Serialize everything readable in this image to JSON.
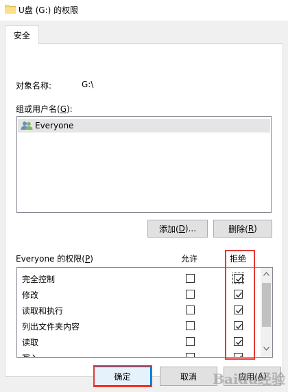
{
  "window": {
    "title": "U盘 (G:) 的权限"
  },
  "tab": {
    "label": "安全"
  },
  "object": {
    "label": "对象名称:",
    "value": "G:\\"
  },
  "group": {
    "label_prefix": "组或用户名(",
    "label_key": "G",
    "label_suffix": "):",
    "items": [
      {
        "name": "Everyone"
      }
    ]
  },
  "buttons": {
    "add_prefix": "添加(",
    "add_key": "D",
    "add_suffix": ")...",
    "remove_prefix": "删除(",
    "remove_key": "R",
    "remove_suffix": ")",
    "ok": "确定",
    "cancel": "取消",
    "apply_prefix": "应用(",
    "apply_key": "A",
    "apply_suffix": ")"
  },
  "permissions": {
    "title_prefix": "Everyone 的权限(",
    "title_key": "P",
    "title_suffix": ")",
    "allow_header": "允许",
    "deny_header": "拒绝",
    "rows": [
      {
        "name": "完全控制",
        "allow": false,
        "deny": true
      },
      {
        "name": "修改",
        "allow": false,
        "deny": true
      },
      {
        "name": "读取和执行",
        "allow": false,
        "deny": true
      },
      {
        "name": "列出文件夹内容",
        "allow": false,
        "deny": true
      },
      {
        "name": "读取",
        "allow": false,
        "deny": true
      },
      {
        "name": "写入",
        "allow": false,
        "deny": true
      }
    ]
  },
  "watermark": {
    "text": "Baidu经验"
  },
  "colors": {
    "highlight": "#e53935",
    "accent": "#0078d7"
  }
}
